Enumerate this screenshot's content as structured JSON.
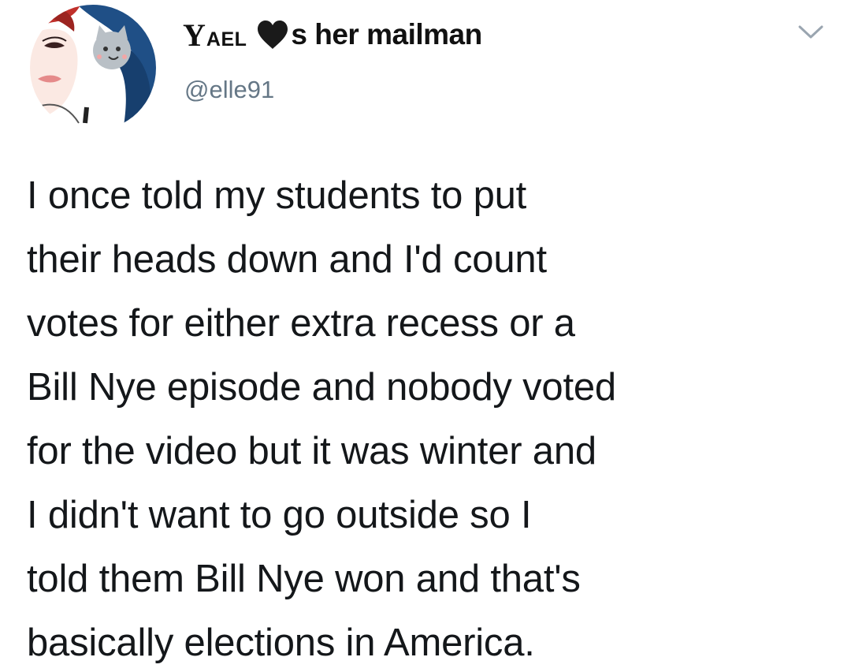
{
  "author": {
    "display_name_first": "Y",
    "display_name_rest": "AEL",
    "display_name_suffix": "s her mailman",
    "handle": "@elle91"
  },
  "icons": {
    "heart": "heart-icon",
    "menu": "chevron-down-icon"
  },
  "tweet": {
    "lines": [
      "I once told my students to put",
      "their heads down and I'd count",
      "votes for either extra recess or a",
      "Bill Nye episode and nobody voted",
      "for the video but it was winter and",
      "I didn't want to go outside so I",
      "told them Bill Nye won and that's",
      "basically elections in America."
    ]
  },
  "colors": {
    "text": "#14171a",
    "handle": "#657786",
    "chevron": "#9aa5b0",
    "heart": "#1a1a1a",
    "avatar_blue": "#1f4f86",
    "avatar_red": "#c0302b"
  }
}
